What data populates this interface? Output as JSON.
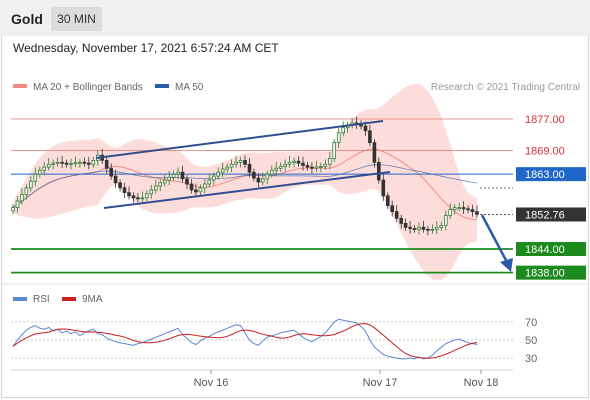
{
  "header": {
    "title": "Gold",
    "timeframe": "30 MIN"
  },
  "date_text": "Wednesday, November 17, 2021 6:57:24 AM CET",
  "legend": {
    "ma20": "MA 20 + Bollinger Bands",
    "ma50": "MA 50",
    "credit": "Research © 2021 Trading Central"
  },
  "rsi_legend": {
    "rsi": "RSI",
    "ma9": "9MA"
  },
  "colors": {
    "up": "#2e7d32",
    "down": "#333333",
    "band": "#fbd4d2",
    "ma20": "#f28b82",
    "ma50": "#2b5aa8",
    "support": "#1d8a1d",
    "pivot": "#1f66c9",
    "last": "#333333",
    "resistance": "#e57373",
    "channel": "#2f4f8f",
    "arrow": "#2b5aa8",
    "rsi": "#5b87d9",
    "rsi_ma": "#cc1f1f"
  },
  "chart_data": {
    "type": "candlestick",
    "instrument": "Gold",
    "timeframe": "30 MIN",
    "ylim": [
      1836,
      1884
    ],
    "x_ticks": [
      "Nov 16",
      "Nov 17",
      "Nov 18"
    ],
    "levels": [
      {
        "label": "1877.00",
        "value": 1877.0,
        "kind": "resistance"
      },
      {
        "label": "1869.00",
        "value": 1869.0,
        "kind": "resistance"
      },
      {
        "label": "1863.00",
        "value": 1863.0,
        "kind": "pivot"
      },
      {
        "label": "1852.76",
        "value": 1852.76,
        "kind": "last"
      },
      {
        "label": "1844.00",
        "value": 1844.0,
        "kind": "support"
      },
      {
        "label": "1838.00",
        "value": 1838.0,
        "kind": "support"
      }
    ],
    "close": [
      1854.5,
      1856.2,
      1857.8,
      1859.5,
      1861.2,
      1863.0,
      1864.0,
      1864.8,
      1865.5,
      1865.8,
      1866.0,
      1865.8,
      1865.5,
      1865.7,
      1865.9,
      1866.0,
      1865.8,
      1865.5,
      1866.5,
      1867.8,
      1866.5,
      1864.5,
      1862.5,
      1860.8,
      1859.5,
      1858.3,
      1857.5,
      1857.0,
      1856.8,
      1857.0,
      1858.0,
      1859.0,
      1860.0,
      1860.8,
      1861.5,
      1862.2,
      1863.0,
      1863.5,
      1861.8,
      1860.5,
      1859.0,
      1858.5,
      1859.5,
      1860.5,
      1861.5,
      1862.5,
      1863.5,
      1864.3,
      1864.8,
      1865.5,
      1866.0,
      1866.5,
      1865.5,
      1863.5,
      1862.0,
      1861.0,
      1861.8,
      1863.0,
      1864.0,
      1864.5,
      1865.0,
      1865.5,
      1866.0,
      1866.3,
      1865.8,
      1865.2,
      1864.8,
      1864.5,
      1864.8,
      1865.0,
      1865.5,
      1867.0,
      1871.0,
      1873.5,
      1874.8,
      1875.5,
      1876.0,
      1875.8,
      1875.2,
      1874.0,
      1871.0,
      1866.0,
      1861.5,
      1857.5,
      1855.0,
      1853.5,
      1851.8,
      1850.5,
      1849.5,
      1849.2,
      1849.0,
      1849.5,
      1849.0,
      1848.8,
      1849.0,
      1849.5,
      1850.0,
      1852.5,
      1854.0,
      1854.5,
      1854.5,
      1854.2,
      1854.0,
      1853.5,
      1852.8
    ],
    "rsi": {
      "ylim": [
        20,
        80
      ],
      "ticks": [
        70,
        50,
        30
      ],
      "values": [
        43,
        50,
        56,
        61,
        64,
        66,
        63,
        62,
        64,
        60,
        62,
        58,
        60,
        57,
        59,
        55,
        58,
        60,
        62,
        57,
        56,
        52,
        50,
        48,
        47,
        46,
        45,
        44,
        46,
        47,
        49,
        51,
        53,
        55,
        57,
        59,
        61,
        63,
        56,
        52,
        47,
        45,
        49,
        52,
        54,
        57,
        59,
        61,
        63,
        65,
        67,
        66,
        58,
        50,
        46,
        44,
        49,
        53,
        55,
        56,
        58,
        59,
        60,
        61,
        57,
        53,
        50,
        48,
        51,
        54,
        58,
        64,
        70,
        73,
        72,
        71,
        70,
        69,
        65,
        60,
        50,
        42,
        38,
        34,
        32,
        31,
        30,
        29,
        29,
        30,
        29,
        31,
        29,
        30,
        33,
        38,
        42,
        46,
        48,
        50,
        51,
        49,
        47,
        46,
        45
      ]
    }
  }
}
